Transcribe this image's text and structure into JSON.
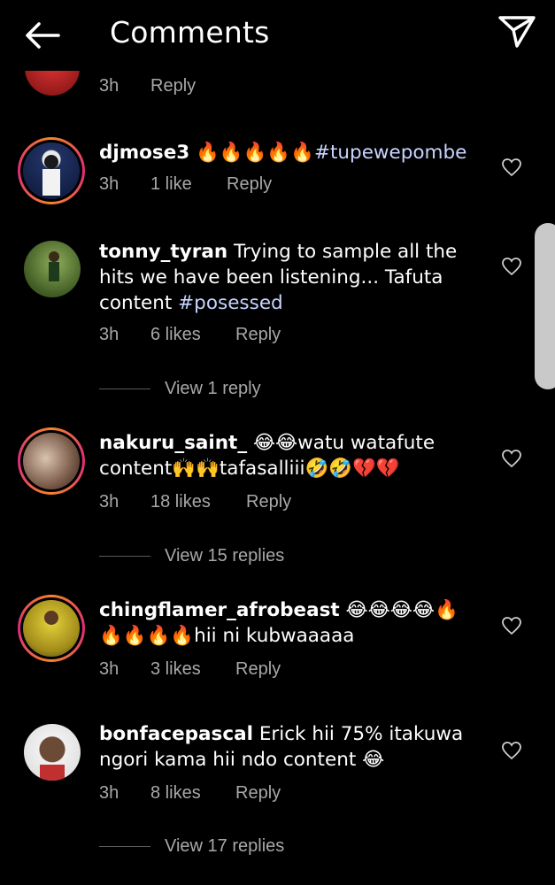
{
  "header": {
    "title": "Comments",
    "back_icon": "arrow-left-icon",
    "share_icon": "paper-plane-icon"
  },
  "partial_comment": {
    "time": "3h",
    "reply_label": "Reply"
  },
  "comments": [
    {
      "username": "djmose3",
      "text": "🔥🔥🔥🔥🔥",
      "hashtag": "#tupewepombe",
      "time": "3h",
      "likes": "1 like",
      "reply_label": "Reply",
      "has_story_ring": true
    },
    {
      "username": "tonny_tyran",
      "text": "Trying to sample all the hits we have been listening... Tafuta content",
      "hashtag": "#posessed",
      "time": "3h",
      "likes": "6 likes",
      "reply_label": "Reply",
      "has_story_ring": false,
      "view_replies": "View 1 reply"
    },
    {
      "username": "nakuru_saint_",
      "text": "😂😂watu watafute content🙌🙌tafasalliii🤣🤣💔💔",
      "time": "3h",
      "likes": "18 likes",
      "reply_label": "Reply",
      "has_story_ring": true,
      "view_replies": "View 15 replies"
    },
    {
      "username": "chingflamer_afrobeast",
      "text": "😂😂😂😂🔥🔥🔥🔥🔥hii ni kubwaaaaa",
      "time": "3h",
      "likes": "3 likes",
      "reply_label": "Reply",
      "has_story_ring": true
    },
    {
      "username": "bonfacepascal",
      "text": "Erick hii 75% itakuwa ngori kama hii ndo content 😂",
      "time": "3h",
      "likes": "8 likes",
      "reply_label": "Reply",
      "has_story_ring": false,
      "view_replies": "View 17 replies"
    }
  ],
  "colors": {
    "background": "#000000",
    "secondary_text": "#a8a8a8",
    "hashtag": "#c7d4ff",
    "story_ring_start": "#f58529",
    "story_ring_end": "#dd2a7b"
  }
}
